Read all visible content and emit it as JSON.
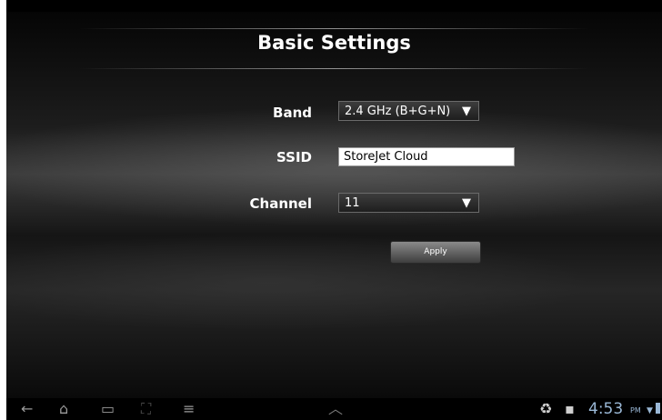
{
  "title": "Basic Settings",
  "form": {
    "band": {
      "label": "Band",
      "value": "2.4 GHz (B+G+N)"
    },
    "ssid": {
      "label": "SSID",
      "value": "StoreJet Cloud"
    },
    "channel": {
      "label": "Channel",
      "value": "11"
    },
    "apply_label": "Apply"
  },
  "icons": {
    "dropdown_arrow": "▼",
    "back": "←",
    "home": "⌂",
    "recent": "▭",
    "screenshot": "⛶",
    "menu": "≡",
    "up": "︿",
    "recycle": "♻",
    "bag": "▪",
    "wifi": "▼"
  },
  "status": {
    "time": "4:53",
    "ampm": "PM"
  },
  "colors": {
    "status_text": "#9ab8d6"
  }
}
